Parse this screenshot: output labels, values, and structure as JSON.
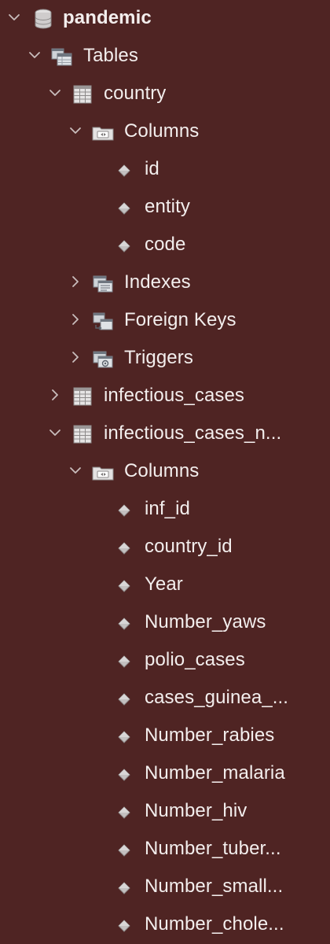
{
  "tree": [
    {
      "label": "pandemic",
      "icon": "database-icon",
      "name": "schema-pandemic",
      "level": 0,
      "expanded": true,
      "bold": true
    },
    {
      "label": "Tables",
      "icon": "tables-folder-icon",
      "name": "tables-folder",
      "level": 1,
      "expanded": true
    },
    {
      "label": "country",
      "icon": "table-icon",
      "name": "table-country",
      "level": 2,
      "expanded": true
    },
    {
      "label": "Columns",
      "icon": "columns-folder-icon",
      "name": "columns-folder-country",
      "level": 3,
      "expanded": true
    },
    {
      "label": "id",
      "icon": "column-icon",
      "name": "column-id",
      "level": 4
    },
    {
      "label": "entity",
      "icon": "column-icon",
      "name": "column-entity",
      "level": 4
    },
    {
      "label": "code",
      "icon": "column-icon",
      "name": "column-code",
      "level": 4
    },
    {
      "label": "Indexes",
      "icon": "indexes-folder-icon",
      "name": "indexes-folder-country",
      "level": 3,
      "expanded": false
    },
    {
      "label": "Foreign Keys",
      "icon": "foreign-keys-folder-icon",
      "name": "foreign-keys-folder-country",
      "level": 3,
      "expanded": false
    },
    {
      "label": "Triggers",
      "icon": "triggers-folder-icon",
      "name": "triggers-folder-country",
      "level": 3,
      "expanded": false
    },
    {
      "label": "infectious_cases",
      "icon": "table-icon",
      "name": "table-infectious-cases",
      "level": 2,
      "expanded": false
    },
    {
      "label": "infectious_cases_n...",
      "icon": "table-icon",
      "name": "table-infectious-cases-n",
      "level": 2,
      "expanded": true
    },
    {
      "label": "Columns",
      "icon": "columns-folder-icon",
      "name": "columns-folder-infectious-cases-n",
      "level": 3,
      "expanded": true
    },
    {
      "label": "inf_id",
      "icon": "column-icon",
      "name": "column-inf-id",
      "level": 4
    },
    {
      "label": "country_id",
      "icon": "column-icon",
      "name": "column-country-id",
      "level": 4
    },
    {
      "label": "Year",
      "icon": "column-icon",
      "name": "column-year",
      "level": 4
    },
    {
      "label": "Number_yaws",
      "icon": "column-icon",
      "name": "column-number-yaws",
      "level": 4
    },
    {
      "label": "polio_cases",
      "icon": "column-icon",
      "name": "column-polio-cases",
      "level": 4
    },
    {
      "label": "cases_guinea_...",
      "icon": "column-icon",
      "name": "column-cases-guinea",
      "level": 4
    },
    {
      "label": "Number_rabies",
      "icon": "column-icon",
      "name": "column-number-rabies",
      "level": 4
    },
    {
      "label": "Number_malaria",
      "icon": "column-icon",
      "name": "column-number-malaria",
      "level": 4
    },
    {
      "label": "Number_hiv",
      "icon": "column-icon",
      "name": "column-number-hiv",
      "level": 4
    },
    {
      "label": "Number_tuber...",
      "icon": "column-icon",
      "name": "column-number-tuber",
      "level": 4
    },
    {
      "label": "Number_small...",
      "icon": "column-icon",
      "name": "column-number-small",
      "level": 4
    },
    {
      "label": "Number_chole...",
      "icon": "column-icon",
      "name": "column-number-chole",
      "level": 4
    }
  ],
  "colors": {
    "background": "#4f2423",
    "text": "#f3eeed",
    "chevron": "#c9bdbc",
    "icon_gray": "#b7b4b4"
  }
}
